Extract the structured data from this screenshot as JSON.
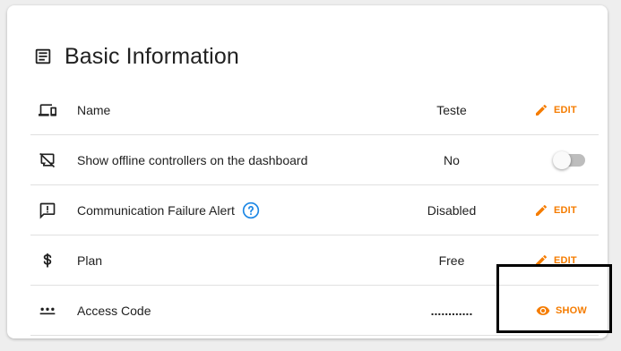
{
  "section": {
    "title": "Basic Information",
    "icon": "description-icon"
  },
  "rows": [
    {
      "icon": "devices-icon",
      "label": "Name",
      "value": "Teste",
      "action": {
        "icon": "pencil-icon",
        "label": "EDIT"
      }
    },
    {
      "icon": "desktop-off-icon",
      "label": "Show offline controllers on the dashboard",
      "value": "No",
      "toggle": {
        "on": false
      }
    },
    {
      "icon": "feedback-icon",
      "label": "Communication Failure Alert",
      "help_icon": "help-circle-icon",
      "value": "Disabled",
      "action": {
        "icon": "pencil-icon",
        "label": "EDIT"
      }
    },
    {
      "icon": "dollar-icon",
      "label": "Plan",
      "value": "Free",
      "action": {
        "icon": "pencil-icon",
        "label": "EDIT"
      }
    },
    {
      "icon": "password-dots-icon",
      "label": "Access Code",
      "value": "............",
      "action": {
        "icon": "eye-icon",
        "label": "SHOW"
      }
    }
  ],
  "colors": {
    "accent": "#f57c00",
    "help": "#1e88e5",
    "text": "#212121",
    "divider": "#e0e0e0",
    "highlight_box": "#000000"
  }
}
